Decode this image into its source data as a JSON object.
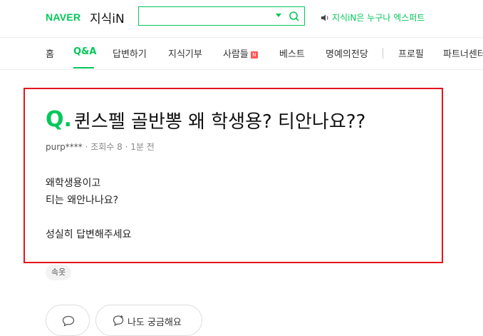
{
  "header": {
    "logo_naver": "NAVER",
    "logo_kin": "지식iN",
    "search_value": "",
    "expert_text": "지식iN은 누구나 엑스퍼트"
  },
  "nav": {
    "tabs": [
      "홈",
      "Q&A",
      "답변하기",
      "지식기부",
      "사람들",
      "베스트",
      "명예의전당",
      "프로필",
      "파트너센터"
    ],
    "new_badge": "N",
    "active_tab": "Q&A"
  },
  "question": {
    "mark": "Q.",
    "title": "퀸스펠 골반뽕 왜 학생용? 티안나요??",
    "author": "purp****",
    "views": "조회수 8",
    "time": "1분 전",
    "body_lines": [
      "왜학생용이고",
      "티는 왜안나나요?",
      "",
      "성실히 답변해주세요"
    ]
  },
  "tags": [
    "속옷"
  ],
  "actions": {
    "curious_label": "나도 궁금해요"
  },
  "colors": {
    "accent": "#03c75a",
    "highlight_border": "#e5131d"
  }
}
